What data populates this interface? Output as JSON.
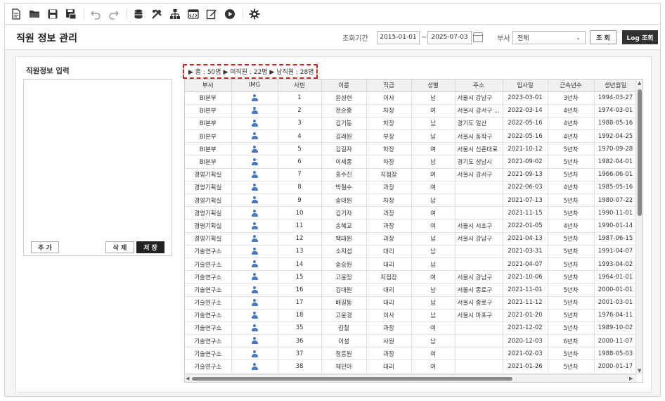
{
  "toolbar": {
    "icons": [
      "new-doc-icon",
      "open-folder-icon",
      "save-icon",
      "save-all-icon",
      "undo-icon",
      "redo-icon",
      "database-icon",
      "tools-icon",
      "org-chart-icon",
      "code-window-icon",
      "edit-icon",
      "play-icon",
      "gear-icon"
    ]
  },
  "header": {
    "title": "직원 정보 관리",
    "period_label": "조회기간",
    "date_from": "2015-01-01",
    "date_sep": "~",
    "date_to": "2025-07-03",
    "dept_label": "부서",
    "dept_value": "전체",
    "search_label": "조 회",
    "log_label": "Log 조회"
  },
  "left": {
    "title": "직원정보 입력",
    "add_label": "추 가",
    "delete_label": "삭 제",
    "save_label": "저 장"
  },
  "summary": {
    "total": "▶ 총 : 50명",
    "female": "▶ 여직원 : 22명",
    "male": "▶ 남직원 : 28명"
  },
  "grid": {
    "headers": [
      "부서",
      "IMG",
      "사번",
      "이름",
      "직급",
      "성별",
      "주소",
      "입사일",
      "근속년수",
      "생년월일"
    ],
    "rows": [
      [
        "BI본부",
        "",
        "1",
        "윤성현",
        "이사",
        "남",
        "서울시 강남구",
        "2023-03-01",
        "3년차",
        "1994-03-27"
      ],
      [
        "BI본부",
        "",
        "2",
        "전순종",
        "차장",
        "여",
        "서울시 강서구 ...",
        "2022-03-14",
        "4년차",
        "1974-03-01"
      ],
      [
        "BI본부",
        "",
        "3",
        "김기동",
        "차장",
        "남",
        "경기도 일산",
        "2022-05-16",
        "4년차",
        "1988-05-16"
      ],
      [
        "BI본부",
        "",
        "4",
        "김래원",
        "부장",
        "남",
        "서울시 동작구",
        "2022-05-16",
        "4년차",
        "1992-04-25"
      ],
      [
        "BI본부",
        "",
        "5",
        "김길자",
        "차장",
        "여",
        "서울시 신촌대로",
        "2021-10-12",
        "5년차",
        "1970-09-28"
      ],
      [
        "BI본부",
        "",
        "6",
        "이세종",
        "차장",
        "남",
        "경기도 성남시",
        "2021-09-02",
        "5년차",
        "1982-04-01"
      ],
      [
        "경영기획실",
        "",
        "7",
        "홍수진",
        "지점장",
        "여",
        "서울시 강서구",
        "2021-09-13",
        "5년차",
        "1966-06-01"
      ],
      [
        "경영기획실",
        "",
        "8",
        "박철수",
        "과장",
        "여",
        "",
        "2022-06-03",
        "4년차",
        "1985-05-16"
      ],
      [
        "경영기획실",
        "",
        "9",
        "송대원",
        "차장",
        "남",
        "",
        "2021-07-13",
        "5년차",
        "1980-07-22"
      ],
      [
        "경영기획실",
        "",
        "10",
        "김기자",
        "과장",
        "여",
        "",
        "2021-11-15",
        "5년차",
        "1990-11-01"
      ],
      [
        "경영기획실",
        "",
        "11",
        "송혜교",
        "과장",
        "여",
        "서울시 서초구",
        "2022-01-05",
        "4년차",
        "1990-01-14"
      ],
      [
        "경영기획실",
        "",
        "12",
        "백대원",
        "과장",
        "남",
        "서울시 강남구",
        "2021-04-13",
        "5년차",
        "1987-06-15"
      ],
      [
        "기술연구소",
        "",
        "13",
        "소지섭",
        "대리",
        "남",
        "",
        "2021-03-31",
        "5년차",
        "1991-04-07"
      ],
      [
        "기술연구소",
        "",
        "14",
        "송승원",
        "대리",
        "남",
        "",
        "2021-04-07",
        "5년차",
        "1993-04-02"
      ],
      [
        "기술연구소",
        "",
        "15",
        "고윤정",
        "지점장",
        "여",
        "서울시 강남구",
        "2021-10-06",
        "5년차",
        "1964-01-01"
      ],
      [
        "기술연구소",
        "",
        "16",
        "김대원",
        "대리",
        "남",
        "서울시 종로구",
        "2021-11-01",
        "5년차",
        "2000-01-01"
      ],
      [
        "기술연구소",
        "",
        "17",
        "배길동",
        "대리",
        "남",
        "서울시 종로구",
        "2021-11-12",
        "5년차",
        "2001-03-01"
      ],
      [
        "기술연구소",
        "",
        "18",
        "고윤경",
        "이사",
        "남",
        "서울시 마포구",
        "2021-01-20",
        "5년차",
        "1976-04-11"
      ],
      [
        "기술연구소",
        "",
        "35",
        "김철",
        "과장",
        "여",
        "",
        "2021-12-02",
        "5년차",
        "1989-10-02"
      ],
      [
        "기술연구소",
        "",
        "36",
        "이설",
        "사원",
        "남",
        "",
        "2020-12-03",
        "6년차",
        "2000-11-07"
      ],
      [
        "기술연구소",
        "",
        "37",
        "정동원",
        "과장",
        "여",
        "",
        "2021-02-03",
        "5년차",
        "1988-05-03"
      ],
      [
        "기술연구소",
        "",
        "38",
        "채민아",
        "대리",
        "여",
        "",
        "2021-01-26",
        "5년차",
        "2000-01-17"
      ]
    ]
  }
}
